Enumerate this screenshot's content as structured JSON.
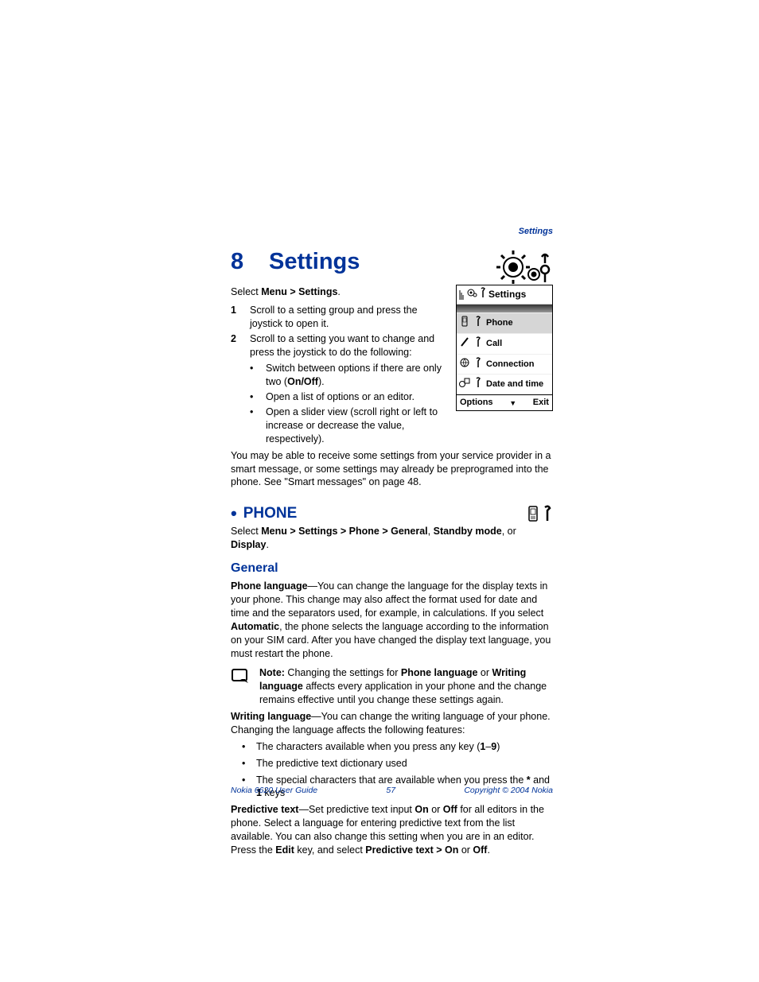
{
  "header": {
    "section": "Settings"
  },
  "chapter": {
    "number": "8",
    "title": "Settings"
  },
  "intro": {
    "select_prefix": "Select ",
    "select_path": "Menu > Settings",
    "period": ".",
    "steps": [
      {
        "n": "1",
        "text": "Scroll to a setting group and press the joystick to open it."
      },
      {
        "n": "2",
        "text": "Scroll to a setting you want to change and press the joystick to do the following:"
      }
    ],
    "substeps": [
      {
        "pre": "Switch between options if there are only two (",
        "bold": "On/Off",
        "post": ")."
      },
      {
        "text": "Open a list of options or an editor."
      },
      {
        "text": "Open a slider view (scroll right or left to increase or decrease the value, respectively)."
      }
    ],
    "after": "You may be able to receive some settings from your service provider in a smart message, or some settings may already be preprogramed into the phone. See \"Smart messages\" on page 48."
  },
  "screenshot": {
    "title": "Settings",
    "rows": [
      {
        "label": "Phone",
        "selected": true
      },
      {
        "label": "Call",
        "selected": false
      },
      {
        "label": "Connection",
        "selected": false
      },
      {
        "label": "Date and time",
        "selected": false
      }
    ],
    "softkeys": {
      "left": "Options",
      "right": "Exit"
    }
  },
  "phone_section": {
    "heading": "PHONE",
    "select_prefix": "Select ",
    "path1": "Menu > Settings > Phone > General",
    "mid1": ", ",
    "path2": "Standby mode",
    "mid2": ", or ",
    "path3": "Display",
    "end": "."
  },
  "general": {
    "heading": "General",
    "p1_a": "Phone language",
    "p1_b": "—You can change the language for the display texts in your phone. This change may also affect the format used for date and time and the separators used, for example, in calculations. If you select ",
    "p1_c": "Automatic",
    "p1_d": ", the phone selects the language according to the information on your SIM card. After you have changed the display text language, you must restart the phone.",
    "note_a": "Note:",
    "note_b": " Changing the settings for ",
    "note_c": "Phone language",
    "note_d": " or ",
    "note_e": "Writing language",
    "note_f": " affects every application in your phone and the change remains effective until you change these settings again.",
    "p2_a": "Writing language",
    "p2_b": "—You can change the writing language of your phone. Changing the language affects the following features:",
    "bullets": [
      {
        "pre": "The characters available when you press any key (",
        "bold": "1",
        "mid": "–",
        "bold2": "9",
        "post": ")"
      },
      {
        "text": "The predictive text dictionary used"
      },
      {
        "pre": "The special characters that are available when you press the ",
        "bold": "*",
        "mid": " and ",
        "bold2": "1",
        "post": " keys"
      }
    ],
    "p3_a": "Predictive text",
    "p3_b": "—Set predictive text input ",
    "p3_c": "On",
    "p3_d": " or ",
    "p3_e": "Off",
    "p3_f": " for all editors in the phone. Select a language for entering predictive text from the list available. You can also change this setting when you are in an editor. Press the ",
    "p3_g": "Edit",
    "p3_h": " key, and select ",
    "p3_i": "Predictive text > On",
    "p3_j": " or ",
    "p3_k": "Off",
    "p3_l": "."
  },
  "footer": {
    "left": "Nokia 6620 User Guide",
    "center": "57",
    "right": "Copyright © 2004 Nokia"
  }
}
